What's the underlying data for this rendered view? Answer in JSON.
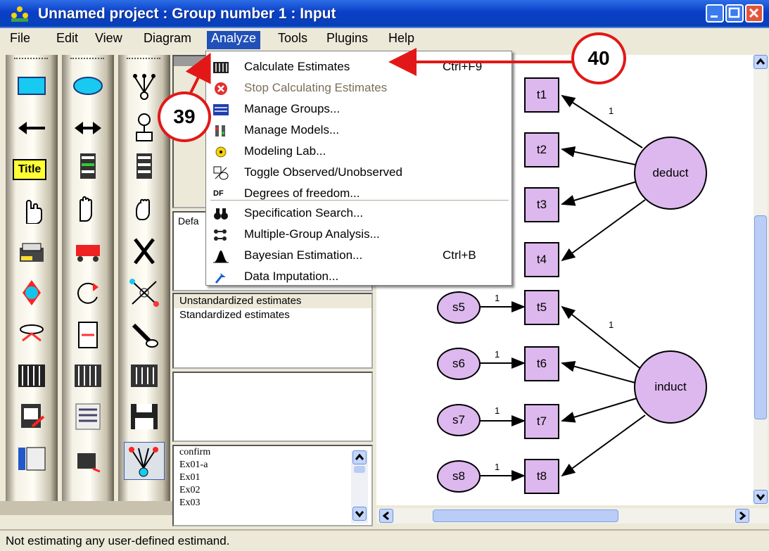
{
  "window": {
    "title": "Unnamed project : Group number 1 : Input"
  },
  "menubar": {
    "items": [
      "File",
      "Edit",
      "View",
      "Diagram",
      "Analyze",
      "Tools",
      "Plugins",
      "Help"
    ],
    "active": "Analyze"
  },
  "analyze_menu": {
    "items": [
      {
        "label": "Calculate Estimates",
        "shortcut": "Ctrl+F9",
        "icon": "calculate-estimates-icon"
      },
      {
        "label": "Stop Calculating Estimates",
        "shortcut": "",
        "icon": "stop-icon",
        "disabled": true
      },
      {
        "label": "Manage Groups...",
        "shortcut": "",
        "icon": "manage-groups-icon"
      },
      {
        "label": "Manage Models...",
        "shortcut": "",
        "icon": "manage-models-icon"
      },
      {
        "label": "Modeling Lab...",
        "shortcut": "",
        "icon": "modeling-lab-icon"
      },
      {
        "label": "Toggle Observed/Unobserved",
        "shortcut": "",
        "icon": "toggle-observed-icon"
      },
      {
        "label": "Degrees of freedom...",
        "shortcut": "",
        "icon": "df-icon",
        "icon_text": "DF"
      },
      {
        "label": "Specification Search...",
        "shortcut": "",
        "icon": "binoculars-icon"
      },
      {
        "label": "Multiple-Group Analysis...",
        "shortcut": "",
        "icon": "multiple-group-icon"
      },
      {
        "label": "Bayesian Estimation...",
        "shortcut": "Ctrl+B",
        "icon": "bayesian-icon"
      },
      {
        "label": "Data Imputation...",
        "shortcut": "",
        "icon": "data-imputation-icon"
      }
    ]
  },
  "callouts": {
    "menu": "39",
    "calc": "40"
  },
  "toolbox": {
    "title_icon_text": "Title"
  },
  "panels": {
    "obscured_fragment_1": "Defa",
    "estimates": [
      "Unstandardized estimates",
      "Standardized estimates"
    ],
    "models": [
      "confirm",
      "Ex01-a",
      "Ex01",
      "Ex02",
      "Ex03"
    ]
  },
  "diagram": {
    "observed": [
      "t1",
      "t2",
      "t3",
      "t4",
      "t5",
      "t6",
      "t7",
      "t8"
    ],
    "errors": [
      "s5",
      "s6",
      "s7",
      "s8"
    ],
    "latent": [
      "deduct",
      "induct"
    ],
    "weights": {
      "deduct_t1": "1",
      "induct_t5": "1",
      "s5": "1",
      "s6": "1",
      "s7": "1",
      "s8": "1"
    },
    "colors": {
      "node_fill": "#ddb8ee"
    }
  },
  "statusbar": {
    "text": "Not estimating any user-defined estimand."
  }
}
